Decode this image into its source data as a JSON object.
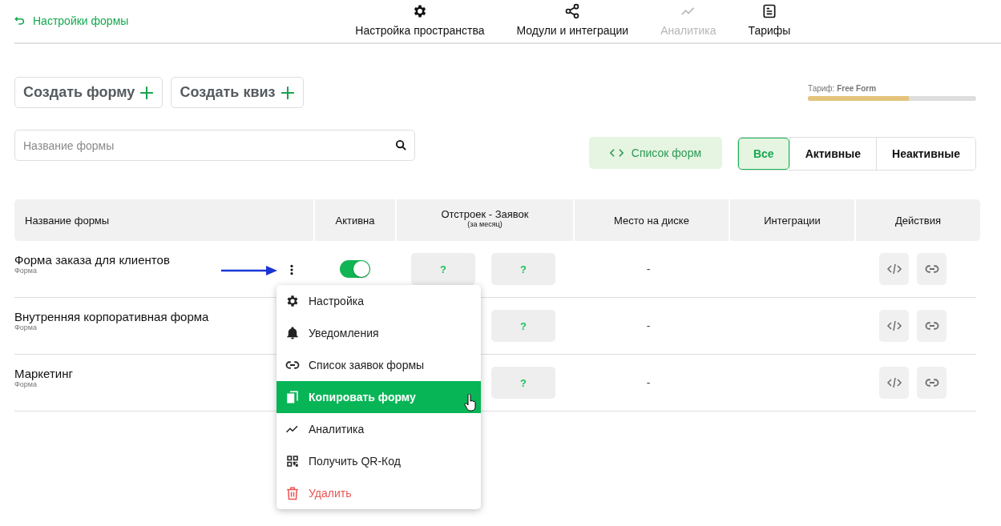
{
  "back_link": {
    "label": "Настройки формы"
  },
  "nav": [
    {
      "label": "Настройка пространства",
      "disabled": false
    },
    {
      "label": "Модули и интеграции",
      "disabled": false
    },
    {
      "label": "Аналитика",
      "disabled": true
    },
    {
      "label": "Тарифы",
      "disabled": false
    }
  ],
  "create_buttons": [
    {
      "label": "Создать форму"
    },
    {
      "label": "Создать квиз"
    }
  ],
  "plan": {
    "label": "Тариф: **Free Form**",
    "level": 0.6
  },
  "search": {
    "placeholder": "Название формы"
  },
  "forms_list_button": {
    "label": "Список форм"
  },
  "filters": [
    {
      "label": "Все",
      "selected": true
    },
    {
      "label": "Активные",
      "selected": false
    },
    {
      "label": "Неактивные",
      "selected": false
    }
  ],
  "table": {
    "columns": [
      {
        "label": "Название формы"
      },
      {
        "label": "Активна"
      },
      {
        "label": "Отстроек - Заявок",
        "sublabel": "(за месяц)"
      },
      {
        "label": "Место на диске"
      },
      {
        "label": "Интеграции"
      },
      {
        "label": "Действия"
      }
    ],
    "rows": [
      {
        "name": "Форма заказа для клиентов",
        "type": "Форма",
        "active": true,
        "stats": [
          "?",
          "?"
        ],
        "disk": "-"
      },
      {
        "name": "Внутренняя корпоративная форма",
        "type": "Форма",
        "stats": [
          "?"
        ],
        "disk": "-"
      },
      {
        "name": "Маркетинг",
        "type": "Форма",
        "stats": [
          "?"
        ],
        "disk": "-"
      }
    ]
  },
  "context_menu": {
    "items": [
      {
        "label": "Настройка",
        "kind": "normal",
        "selected": false
      },
      {
        "label": "Уведомления",
        "kind": "normal",
        "selected": false
      },
      {
        "label": "Список заявок формы",
        "kind": "normal",
        "selected": false
      },
      {
        "label": "Копировать форму",
        "kind": "normal",
        "selected": true
      },
      {
        "label": "Аналитика",
        "kind": "normal",
        "selected": false
      },
      {
        "label": "Получить QR-Код",
        "kind": "normal",
        "selected": false
      },
      {
        "label": "Удалить",
        "kind": "danger",
        "selected": false
      }
    ]
  }
}
